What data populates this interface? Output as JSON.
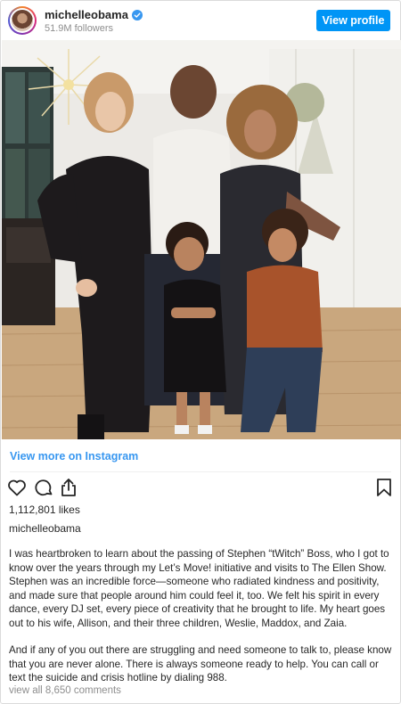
{
  "header": {
    "username": "michelleobama",
    "followers": "51.9M followers",
    "view_profile_label": "View profile"
  },
  "post": {
    "view_more_label": "View more on Instagram",
    "likes": "1,112,801 likes",
    "owner": "michelleobama",
    "caption_p1": "I was heartbroken to learn about the passing of Stephen “tWitch” Boss, who I got to know over the years through my Let’s Move! initiative and visits to The Ellen Show. Stephen was an incredible force—someone who radiated kindness and positivity, and made sure that people around him could feel it, too. We felt his spirit in every dance, every DJ set, every piece of creativity that he brought to life. My heart goes out to his wife, Allison, and their three children, Weslie, Maddox, and Zaia.",
    "caption_p2": "And if any of you out there are struggling and need someone to talk to, please know that you are never alone. There is always someone ready to help. You can call or text the suicide and crisis hotline by dialing 988.",
    "comments_label": "view all 8,650 comments"
  },
  "icons": {
    "verified": "verified-badge-icon",
    "like": "heart-icon",
    "comment": "comment-bubble-icon",
    "share": "share-icon",
    "save": "bookmark-icon"
  },
  "colors": {
    "accent": "#0095f6",
    "link": "#3897f0",
    "muted": "#8e8e8e"
  }
}
